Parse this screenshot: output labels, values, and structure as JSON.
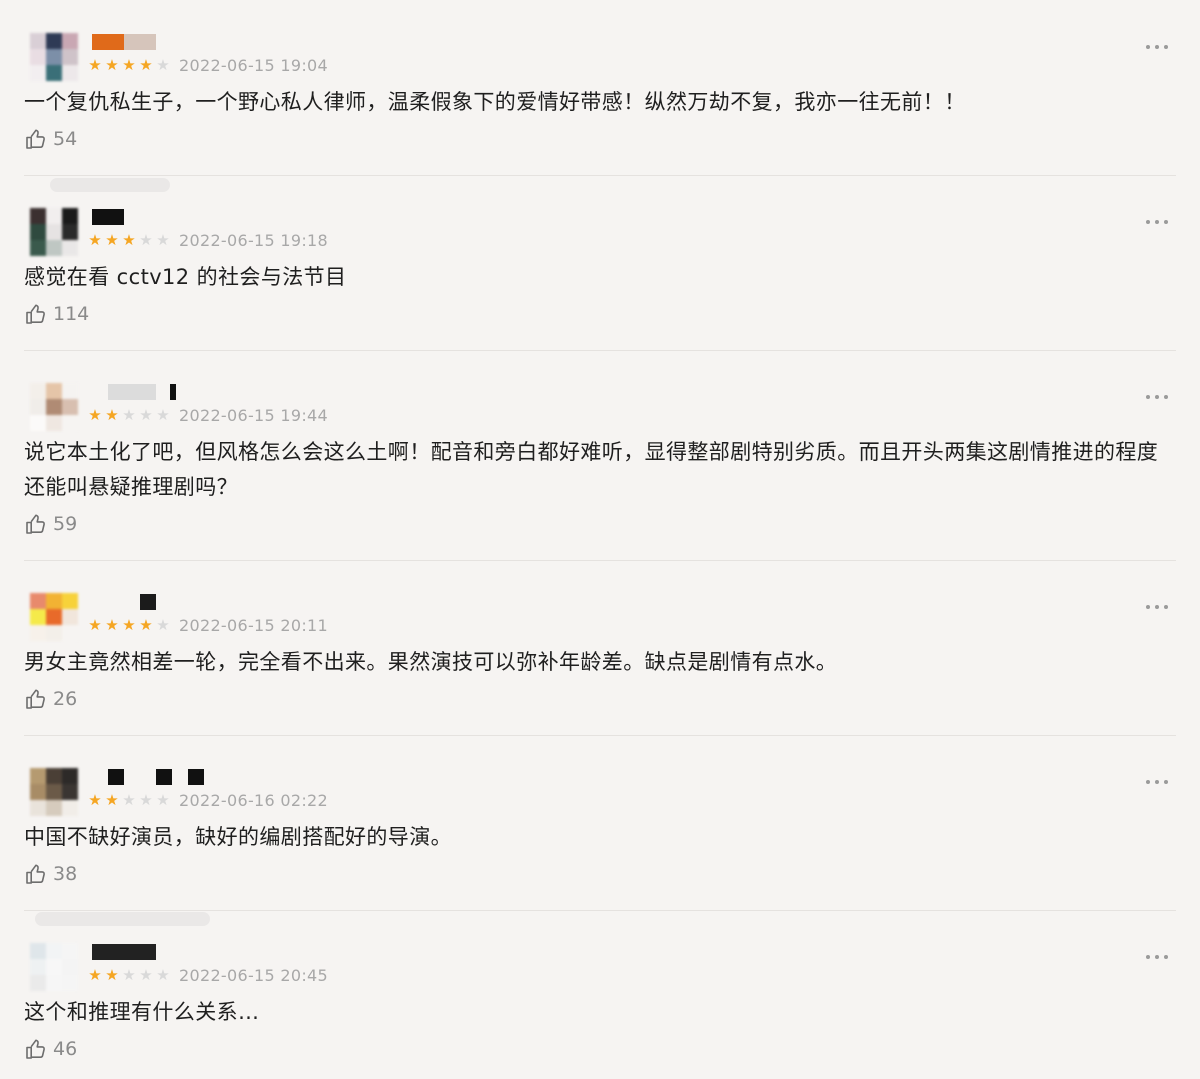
{
  "comments": [
    {
      "time": "2022-06-15 19:04",
      "rating": 4,
      "text": "一个复仇私生子，一个野心私人律师，温柔假象下的爱情好带感！纵然万劫不复，我亦一往无前！！",
      "likes": "54",
      "avatar_colors": [
        "#d9cfd6",
        "#2e3a55",
        "#c9a7b3",
        "#e9dde3",
        "#7c8fa8",
        "#cfc3c9",
        "#f2eef0",
        "#3a6f78",
        "#ede8ea"
      ],
      "name_blocks": [
        "#e06a1a",
        "#d6c5bb"
      ]
    },
    {
      "time": "2022-06-15 19:18",
      "rating": 3,
      "text": "感觉在看 cctv12 的社会与法节目",
      "likes": "114",
      "avatar_colors": [
        "#3b3030",
        "#f1eeee",
        "#1a1a1a",
        "#2f4a3f",
        "#e6e3e3",
        "#2a2a2a",
        "#3a5a4c",
        "#bfc7c3",
        "#e9e7e7"
      ],
      "name_blocks": [
        "#111111"
      ]
    },
    {
      "time": "2022-06-15 19:44",
      "rating": 2,
      "text": "说它本土化了吧，但风格怎么会这么土啊！配音和旁白都好难听，显得整部剧特别劣质。而且开头两集这剧情推进的程度还能叫悬疑推理剧吗？",
      "likes": "59",
      "avatar_colors": [
        "#f3efea",
        "#e5c5a8",
        "#f5f3f1",
        "#f0ede9",
        "#b08b74",
        "#d8bfb0",
        "#fbfaf9",
        "#efe7e1",
        "#f6f4f2"
      ],
      "name_blocks": [
        "#dcdcdc",
        "#111111"
      ]
    },
    {
      "time": "2022-06-15 20:11",
      "rating": 4,
      "text": "男女主竟然相差一轮，完全看不出来。果然演技可以弥补年龄差。缺点是剧情有点水。",
      "likes": "26",
      "avatar_colors": [
        "#e88a6c",
        "#f2b233",
        "#f7d23a",
        "#f5ea4a",
        "#e86a2a",
        "#f1e6dc",
        "#f7f1ea",
        "#f3efe9",
        "#f6f4f2"
      ],
      "name_blocks": [
        "#1b1b1b"
      ]
    },
    {
      "time": "2022-06-16 02:22",
      "rating": 2,
      "text": "中国不缺好演员，缺好的编剧搭配好的导演。",
      "likes": "38",
      "avatar_colors": [
        "#b59a70",
        "#4a3f36",
        "#2d2a28",
        "#a88c66",
        "#6b5a48",
        "#3a3532",
        "#e9e3db",
        "#d6cbbd",
        "#f1ede8"
      ],
      "name_blocks": [
        "#111111",
        "#111111",
        "#111111"
      ]
    },
    {
      "time": "2022-06-15 20:45",
      "rating": 2,
      "text": "这个和推理有什么关系…",
      "likes": "46",
      "avatar_colors": [
        "#dfe6ea",
        "#f2f4f5",
        "#f5f5f5",
        "#eef1f2",
        "#f7f7f7",
        "#f4f4f4",
        "#eaeaea",
        "#f6f6f6",
        "#f5f5f5"
      ],
      "name_blocks": [
        "#222222"
      ]
    }
  ]
}
